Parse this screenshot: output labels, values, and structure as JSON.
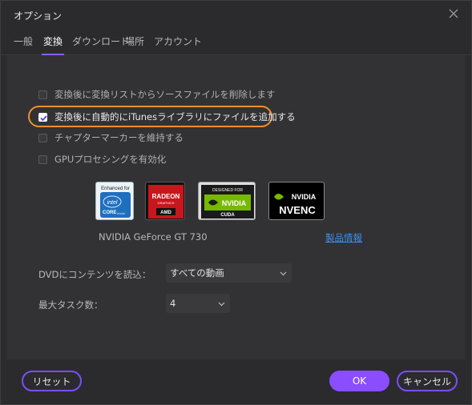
{
  "window": {
    "title": "オプション"
  },
  "tabs": [
    {
      "label": "一般"
    },
    {
      "label": "変換"
    },
    {
      "label": "ダウンロード"
    },
    {
      "label": "場所"
    },
    {
      "label": "アカウント"
    }
  ],
  "active_tab": "変換",
  "options": [
    {
      "label": "変換後に変換リストからソースファイルを削除します",
      "checked": false
    },
    {
      "label": "変換後に自動的にiTunesライブラリにファイルを追加する",
      "checked": true
    },
    {
      "label": "チャプターマーカーを維持する",
      "checked": false
    },
    {
      "label": "GPUプロセシングを有効化",
      "checked": false
    }
  ],
  "logos": {
    "intel": {
      "top": "Enhanced for",
      "brand": "intel",
      "sub": "CORE",
      "tag": "inside"
    },
    "amd": {
      "title": "RADEON",
      "sub": "GRAPHICS",
      "brand": "AMD"
    },
    "cuda": {
      "top": "DESIGNED FOR",
      "brand": "NVIDIA",
      "sub": "CUDA"
    },
    "nvenc": {
      "brand": "NVIDIA",
      "sub": "NVENC"
    }
  },
  "gpu": {
    "name": "NVIDIA GeForce GT 730",
    "link": "製品情報"
  },
  "dvd": {
    "label": "DVDにコンテンツを読込：",
    "value": "すべての動画"
  },
  "tasks": {
    "label": "最大タスク数：",
    "value": "4"
  },
  "buttons": {
    "reset": "リセット",
    "ok": "OK",
    "cancel": "キャンセル"
  },
  "colors": {
    "accent": "#8a4dff",
    "highlight": "#f0902a",
    "link": "#3f8fe8",
    "background": "#2b2b2d"
  }
}
